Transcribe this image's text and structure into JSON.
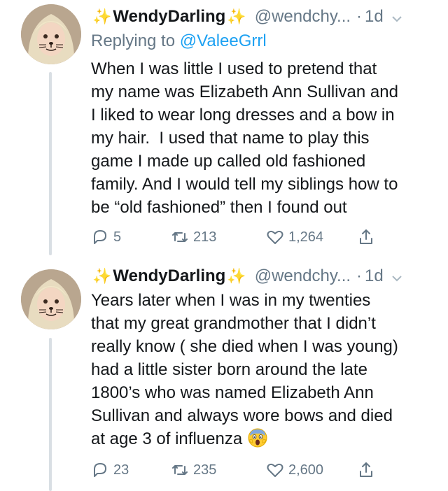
{
  "tweets": [
    {
      "display_name": "WendyDarling",
      "handle": "@wendchy...",
      "separator": "·",
      "time": "1d",
      "reply_prefix": "Replying to",
      "reply_to": "@ValeeGrrl",
      "text": "When I was little I used to pretend that\nmy name was Elizabeth Ann Sullivan and\nI liked to wear long dresses and a bow in\nmy hair.  I used that name to play this\ngame I made up called old fashioned\nfamily. And I would tell my siblings how to\nbe “old fashioned” then I found out",
      "replies": "5",
      "retweets": "213",
      "likes": "1,264"
    },
    {
      "display_name": "WendyDarling",
      "handle": "@wendchy...",
      "separator": "·",
      "time": "1d",
      "text": "Years later when I was in my twenties\nthat my great grandmother that I didn’t\nreally know ( she died when I was young)\nhad a little sister born around the late\n1800’s who was named Elizabeth Ann\nSullivan and always wore bows and died\nat age 3 of influenza",
      "replies": "23",
      "retweets": "235",
      "likes": "2,600"
    }
  ],
  "icons": {
    "name_decoration": "sparkles-icon",
    "menu": "chevron-down-icon",
    "reply": "reply-icon",
    "retweet": "retweet-icon",
    "like": "heart-icon",
    "share": "share-icon",
    "emoji": "face-screaming-in-fear-emoji"
  },
  "colors": {
    "link": "#1da1f2",
    "muted": "#657786",
    "text": "#14171a",
    "thread_line": "#d9dfe4",
    "sparkle": "#f5b800"
  }
}
